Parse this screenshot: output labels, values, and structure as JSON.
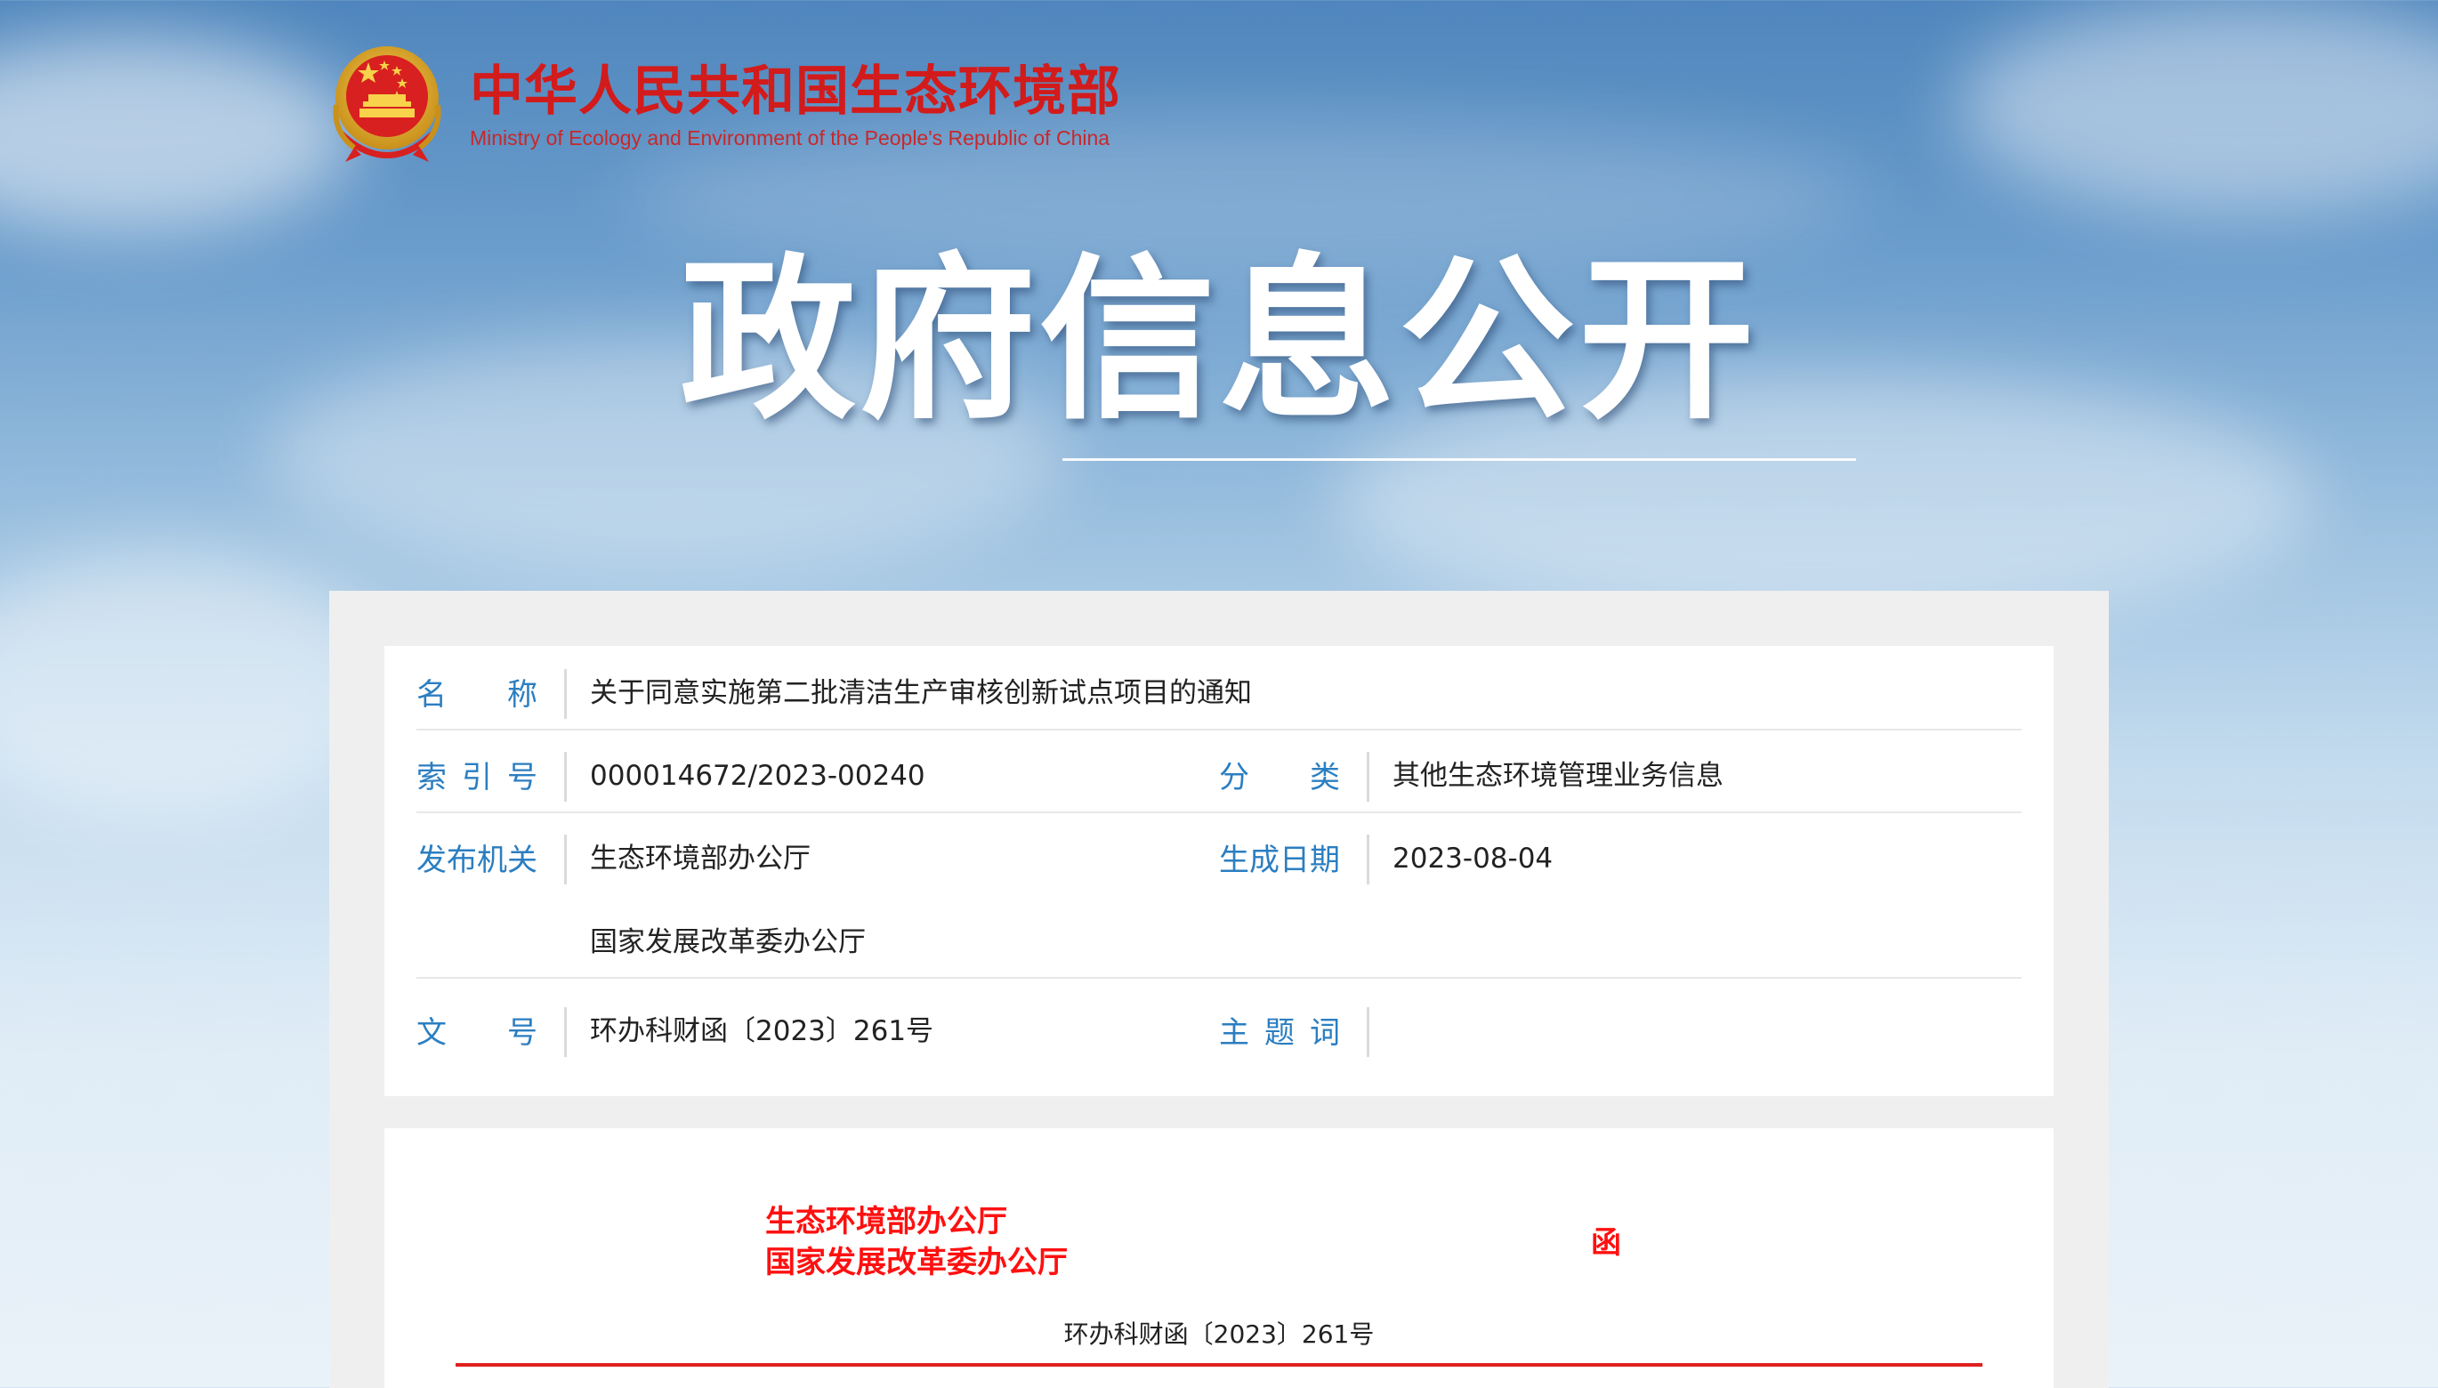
{
  "header": {
    "title_cn": "中华人民共和国生态环境部",
    "title_en": "Ministry of Ecology and Environment of the People's Republic of China",
    "emblem_icon": "national-emblem-icon"
  },
  "hero": {
    "title": "政府信息公开"
  },
  "info": {
    "name_label": "名　称",
    "name_value": "关于同意实施第二批清洁生产审核创新试点项目的通知",
    "index_label": "索引号",
    "index_value": "000014672/2023-00240",
    "category_label": "分　类",
    "category_value": "其他生态环境管理业务信息",
    "issuer_label": "发布机关",
    "issuer_values": [
      "生态环境部办公厅",
      "国家发展改革委办公厅"
    ],
    "date_label": "生成日期",
    "date_value": "2023-08-04",
    "docno_label": "文　号",
    "docno_value": "环办科财函〔2023〕261号",
    "keywords_label": "主题词",
    "keywords_value": ""
  },
  "document": {
    "issuers": [
      "生态环境部办公厅",
      "国家发展改革委办公厅"
    ],
    "type_mark": "函",
    "doc_number": "环办科财函〔2023〕261号"
  },
  "colors": {
    "brand_red": "#d21b1b",
    "label_blue": "#2b7ec1",
    "doc_red": "#ff1010"
  }
}
